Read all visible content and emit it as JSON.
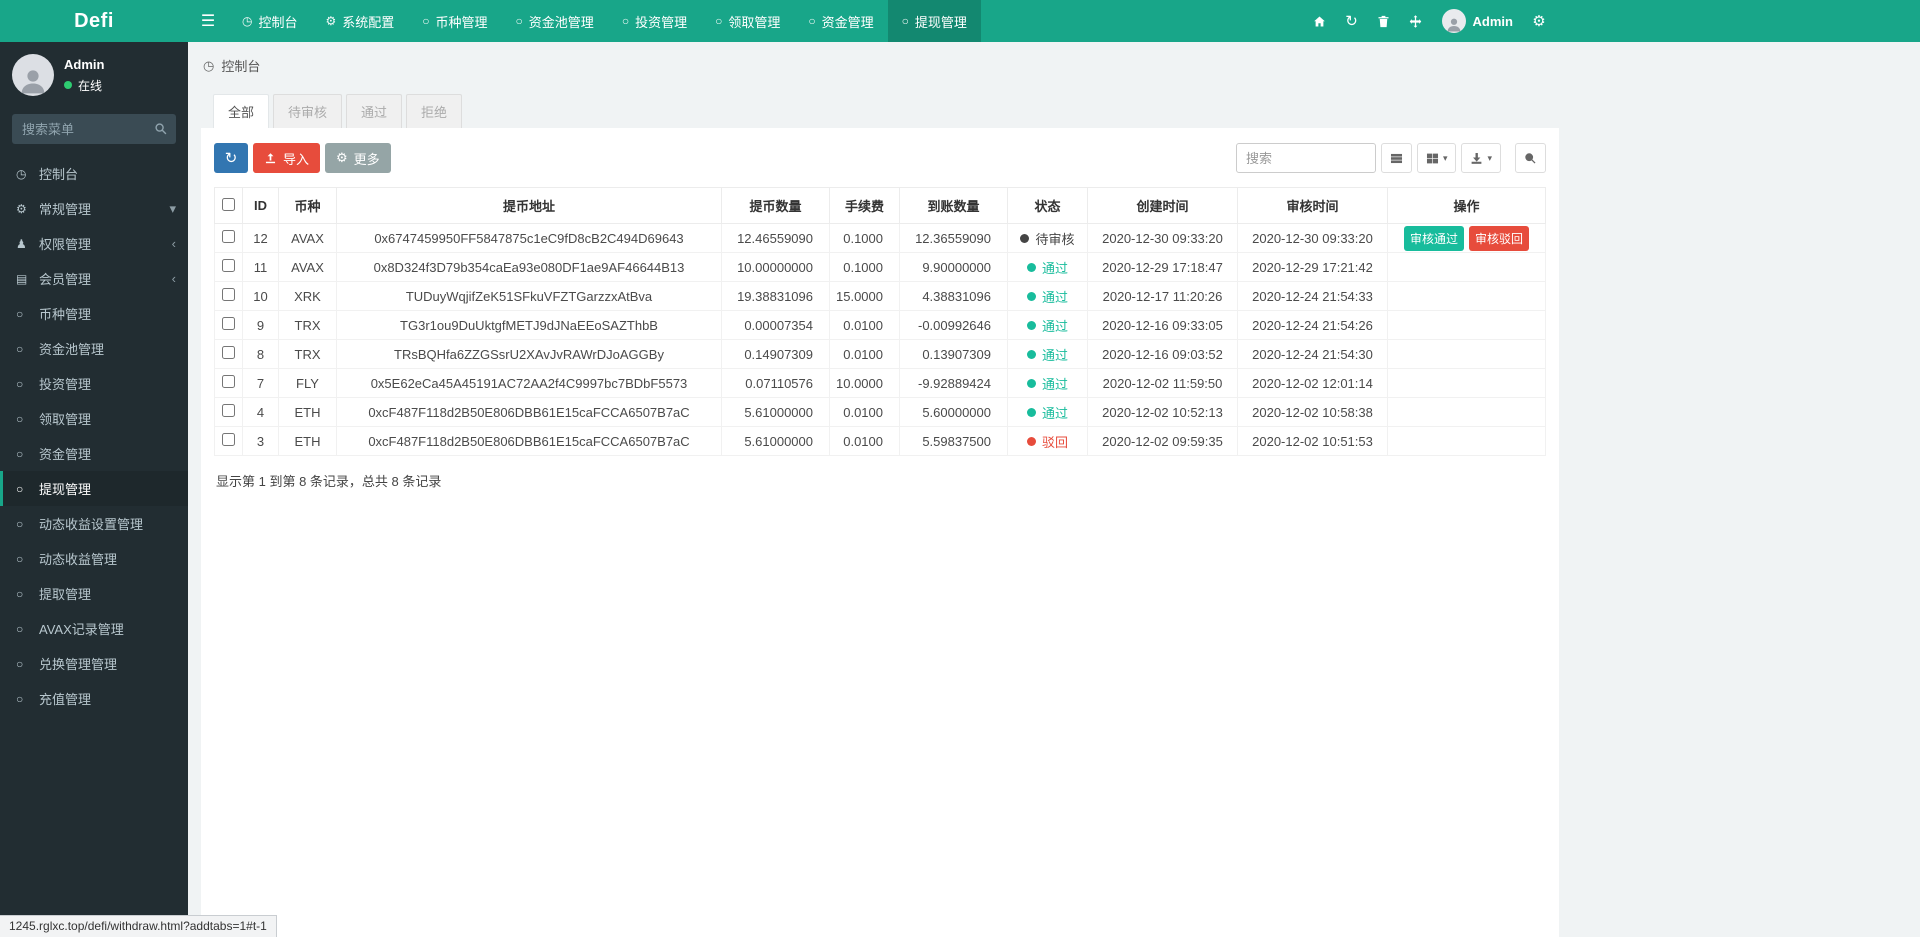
{
  "topbar": {
    "logo": "Defi",
    "nav_items": [
      {
        "label": "控制台",
        "icon": "dashboard"
      },
      {
        "label": "系统配置",
        "icon": "gear"
      },
      {
        "label": "币种管理",
        "icon": "circle"
      },
      {
        "label": "资金池管理",
        "icon": "circle"
      },
      {
        "label": "投资管理",
        "icon": "circle"
      },
      {
        "label": "领取管理",
        "icon": "circle"
      },
      {
        "label": "资金管理",
        "icon": "circle"
      },
      {
        "label": "提现管理",
        "icon": "circle",
        "active": true
      }
    ],
    "user_name": "Admin"
  },
  "sidebar": {
    "user": {
      "name": "Admin",
      "status_label": "在线"
    },
    "search_placeholder": "搜索菜单",
    "menu": [
      {
        "label": "控制台",
        "icon": "dashboard"
      },
      {
        "label": "常规管理",
        "icon": "gears",
        "arrow": "down"
      },
      {
        "label": "权限管理",
        "icon": "users",
        "arrow": "left"
      },
      {
        "label": "会员管理",
        "icon": "list",
        "arrow": "left"
      },
      {
        "label": "币种管理",
        "icon": "circle"
      },
      {
        "label": "资金池管理",
        "icon": "circle"
      },
      {
        "label": "投资管理",
        "icon": "circle"
      },
      {
        "label": "领取管理",
        "icon": "circle"
      },
      {
        "label": "资金管理",
        "icon": "circle"
      },
      {
        "label": "提现管理",
        "icon": "circle",
        "active": true
      },
      {
        "label": "动态收益设置管理",
        "icon": "circle"
      },
      {
        "label": "动态收益管理",
        "icon": "circle"
      },
      {
        "label": "提取管理",
        "icon": "circle"
      },
      {
        "label": "AVAX记录管理",
        "icon": "circle"
      },
      {
        "label": "兑换管理管理",
        "icon": "circle"
      },
      {
        "label": "充值管理",
        "icon": "circle"
      }
    ]
  },
  "breadcrumb": {
    "label": "控制台"
  },
  "tabs": [
    {
      "label": "全部",
      "active": true
    },
    {
      "label": "待审核"
    },
    {
      "label": "通过"
    },
    {
      "label": "拒绝"
    }
  ],
  "toolbar": {
    "import_label": "导入",
    "more_label": "更多",
    "search_placeholder": "搜索"
  },
  "table": {
    "headers": [
      "ID",
      "币种",
      "提币地址",
      "提币数量",
      "手续费",
      "到账数量",
      "状态",
      "创建时间",
      "审核时间",
      "操作"
    ],
    "rows": [
      {
        "id": "12",
        "coin": "AVAX",
        "address": "0x6747459950FF5847875c1eC9fD8cB2C494D69643",
        "amount": "12.46559090",
        "fee": "0.1000",
        "received": "12.36559090",
        "status": {
          "label": "待审核",
          "type": "pending"
        },
        "created": "2020-12-30 09:33:20",
        "reviewed": "2020-12-30 09:33:20",
        "actions": [
          "审核通过",
          "审核驳回"
        ]
      },
      {
        "id": "11",
        "coin": "AVAX",
        "address": "0x8D324f3D79b354caEa93e080DF1ae9AF46644B13",
        "amount": "10.00000000",
        "fee": "0.1000",
        "received": "9.90000000",
        "status": {
          "label": "通过",
          "type": "pass"
        },
        "created": "2020-12-29 17:18:47",
        "reviewed": "2020-12-29 17:21:42",
        "actions": []
      },
      {
        "id": "10",
        "coin": "XRK",
        "address": "TUDuyWqjifZeK51SFkuVFZTGarzzxAtBva",
        "amount": "19.38831096",
        "fee": "15.0000",
        "received": "4.38831096",
        "status": {
          "label": "通过",
          "type": "pass"
        },
        "created": "2020-12-17 11:20:26",
        "reviewed": "2020-12-24 21:54:33",
        "actions": []
      },
      {
        "id": "9",
        "coin": "TRX",
        "address": "TG3r1ou9DuUktgfMETJ9dJNaEEoSAZThbB",
        "amount": "0.00007354",
        "fee": "0.0100",
        "received": "-0.00992646",
        "status": {
          "label": "通过",
          "type": "pass"
        },
        "created": "2020-12-16 09:33:05",
        "reviewed": "2020-12-24 21:54:26",
        "actions": []
      },
      {
        "id": "8",
        "coin": "TRX",
        "address": "TRsBQHfa6ZZGSsrU2XAvJvRAWrDJoAGGBy",
        "amount": "0.14907309",
        "fee": "0.0100",
        "received": "0.13907309",
        "status": {
          "label": "通过",
          "type": "pass"
        },
        "created": "2020-12-16 09:03:52",
        "reviewed": "2020-12-24 21:54:30",
        "actions": []
      },
      {
        "id": "7",
        "coin": "FLY",
        "address": "0x5E62eCa45A45191AC72AA2f4C9997bc7BDbF5573",
        "amount": "0.07110576",
        "fee": "10.0000",
        "received": "-9.92889424",
        "status": {
          "label": "通过",
          "type": "pass"
        },
        "created": "2020-12-02 11:59:50",
        "reviewed": "2020-12-02 12:01:14",
        "actions": []
      },
      {
        "id": "4",
        "coin": "ETH",
        "address": "0xcF487F118d2B50E806DBB61E15caFCCA6507B7aC",
        "amount": "5.61000000",
        "fee": "0.0100",
        "received": "5.60000000",
        "status": {
          "label": "通过",
          "type": "pass"
        },
        "created": "2020-12-02 10:52:13",
        "reviewed": "2020-12-02 10:58:38",
        "actions": []
      },
      {
        "id": "3",
        "coin": "ETH",
        "address": "0xcF487F118d2B50E806DBB61E15caFCCA6507B7aC",
        "amount": "5.61000000",
        "fee": "0.0100",
        "received": "5.59837500",
        "status": {
          "label": "驳回",
          "type": "reject"
        },
        "created": "2020-12-02 09:59:35",
        "reviewed": "2020-12-02 10:51:53",
        "actions": []
      }
    ],
    "summary": "显示第 1 到第 8 条记录，总共 8 条记录"
  },
  "statusbar": {
    "text": "1245.rglxc.top/defi/withdraw.html?addtabs=1#t-1"
  },
  "colors": {
    "topbar_teal": "#18a689",
    "sidebar_bg": "#222d32",
    "status_pass_green": "#18bc9c",
    "status_reject_red": "#e74c3c",
    "primary_blue": "#3276b1",
    "secondary_gray": "#95a5a6",
    "online_green": "#2ecc71"
  }
}
